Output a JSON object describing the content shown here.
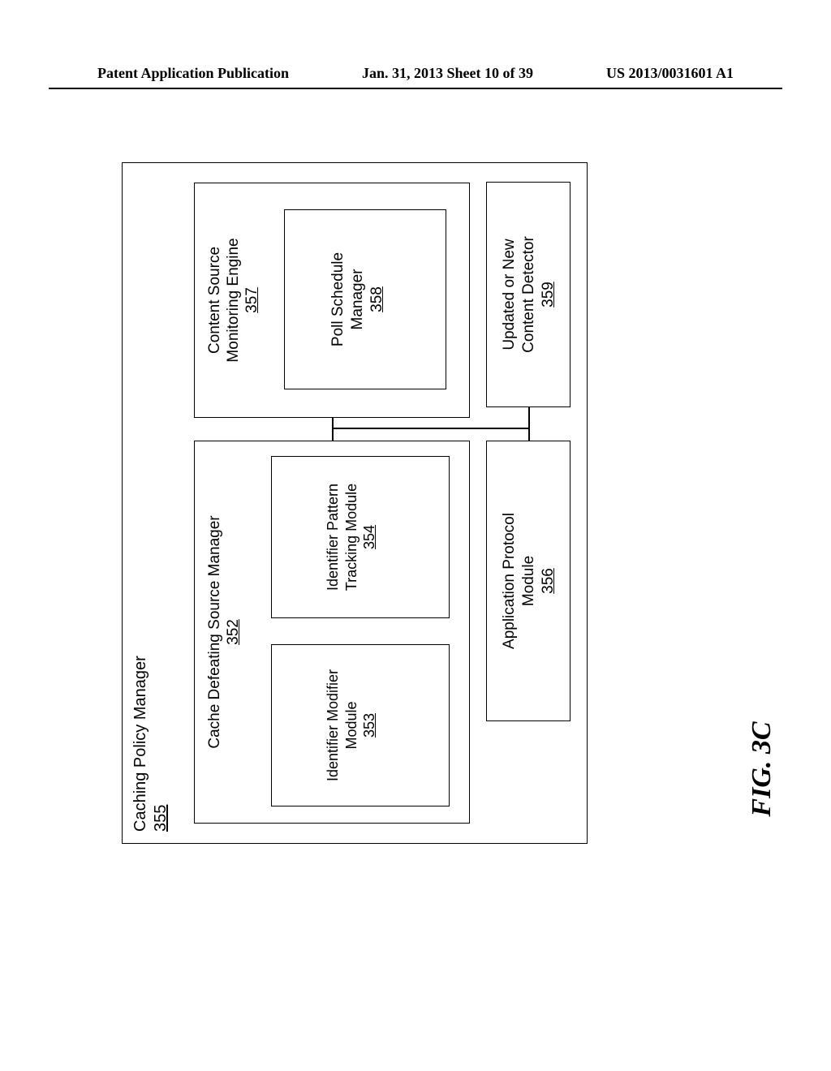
{
  "header": {
    "left": "Patent Application Publication",
    "center": "Jan. 31, 2013  Sheet 10 of 39",
    "right": "US 2013/0031601 A1"
  },
  "figure_label": "FIG. 3C",
  "outer": {
    "title": "Caching Policy Manager",
    "ref": "355"
  },
  "cdsm": {
    "title": "Cache Defeating Source Manager",
    "ref": "352"
  },
  "idmod": {
    "title_l1": "Identifier Modifier",
    "title_l2": "Module",
    "ref": "353"
  },
  "idpat": {
    "title_l1": "Identifier Pattern",
    "title_l2": "Tracking Module",
    "ref": "354"
  },
  "approto": {
    "title_l1": "Application Protocol",
    "title_l2": "Module",
    "ref": "356"
  },
  "csme": {
    "title_l1": "Content Source",
    "title_l2": "Monitoring Engine",
    "ref": "357"
  },
  "psm": {
    "title_l1": "Poll Schedule",
    "title_l2": "Manager",
    "ref": "358"
  },
  "uncd": {
    "title_l1": "Updated or New",
    "title_l2": "Content Detector",
    "ref": "359"
  }
}
